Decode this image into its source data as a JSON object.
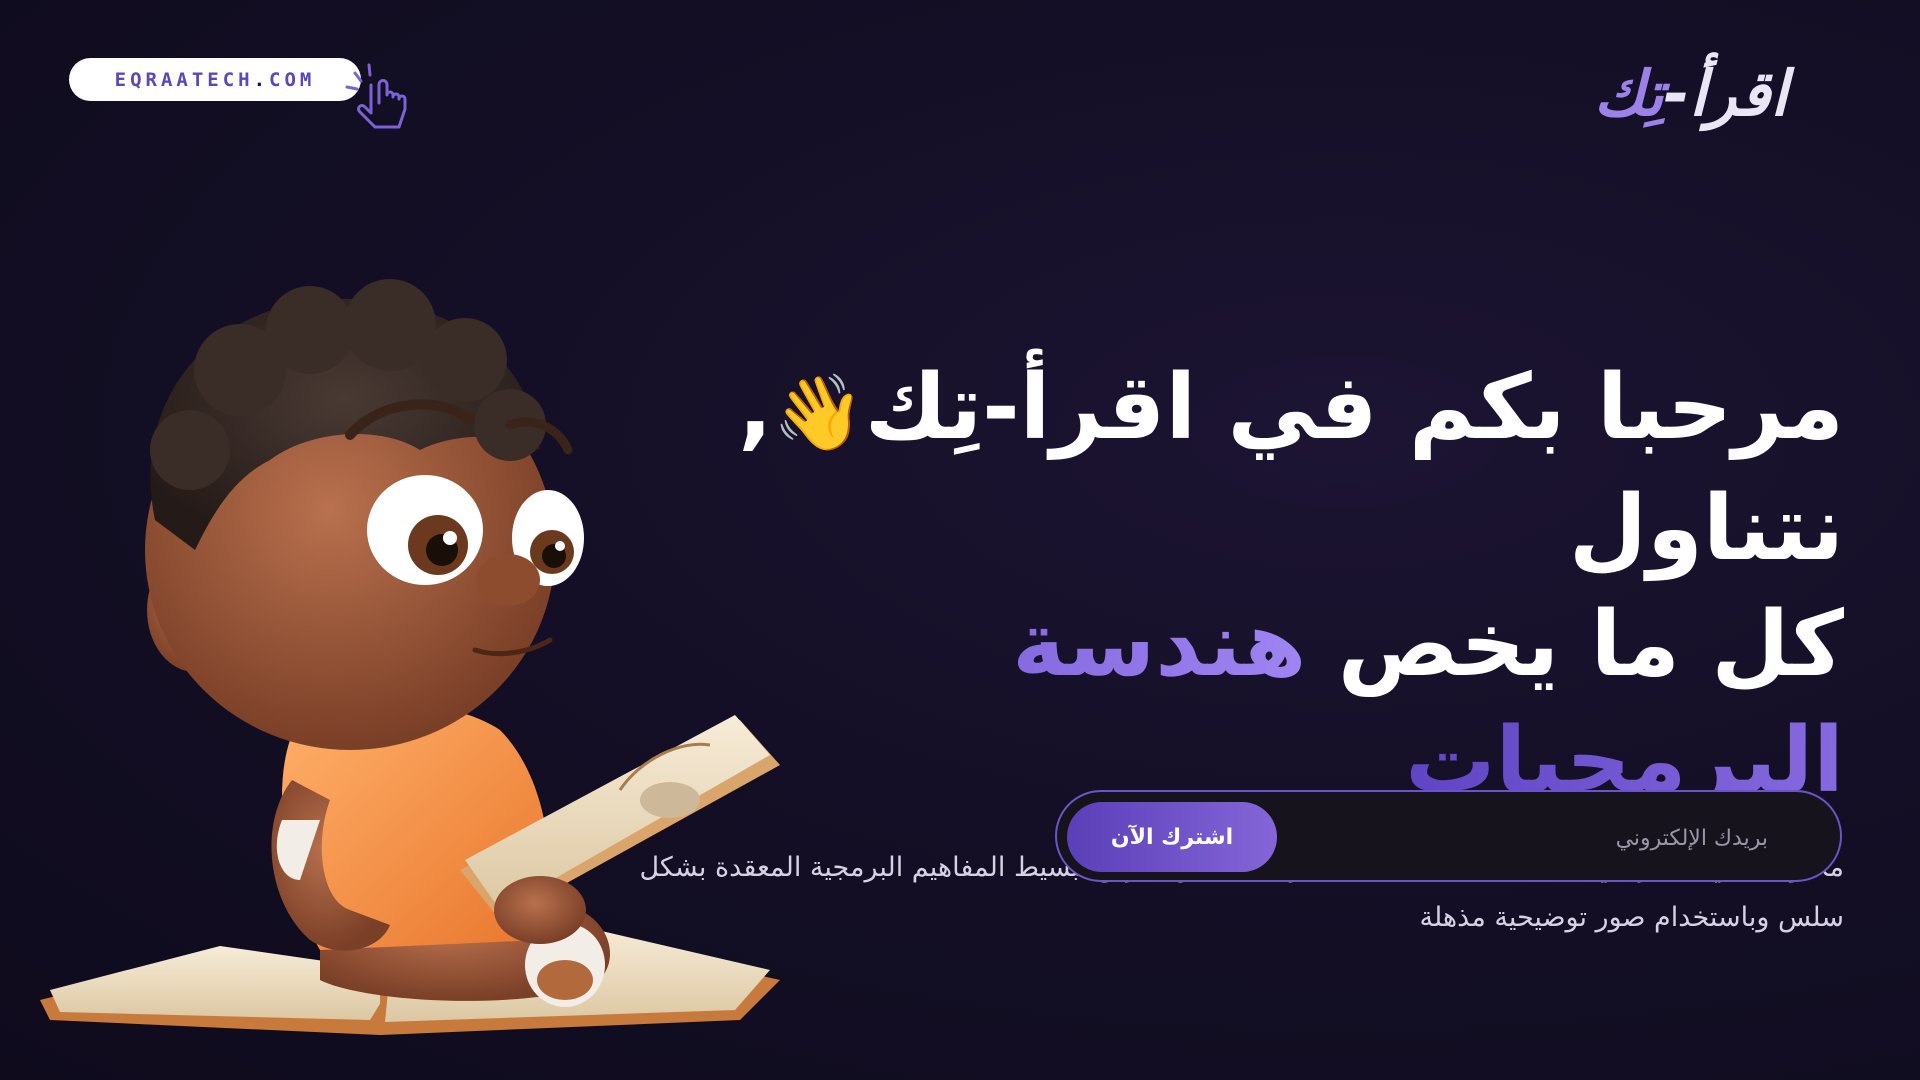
{
  "header": {
    "url_text": "EQRAATECH",
    "url_dot": ".",
    "url_tld": "COM",
    "logo_part1": "اقرأ-",
    "logo_part2": "تِك"
  },
  "hero": {
    "headline_part1": "مرحبا بكم في اقرأ-تِك",
    "wave_emoji": "👋",
    "headline_part2": ", نتناول",
    "headline_line2": "كل ما يخص",
    "headline_accent": "هندسة البرمجيات",
    "subtitle": "محتوى تقني متميز في مختلف مجالات هندسة البرمجيات عن طريق تبسيط المفاهيم البرمجية المعقدة بشكل سلس وباستخدام صور توضيحية مذهلة"
  },
  "subscribe": {
    "email_placeholder": "بريدك الإلكتروني",
    "button_label": "اشترك الآن"
  },
  "icons": {
    "cursor": "pointer-hand-click-icon",
    "illustration": "child-reading-book-illustration"
  },
  "colors": {
    "background": "#140f26",
    "accent": "#8466d8",
    "accent_dark": "#5b3fb8",
    "url_text": "#5c46b8"
  }
}
